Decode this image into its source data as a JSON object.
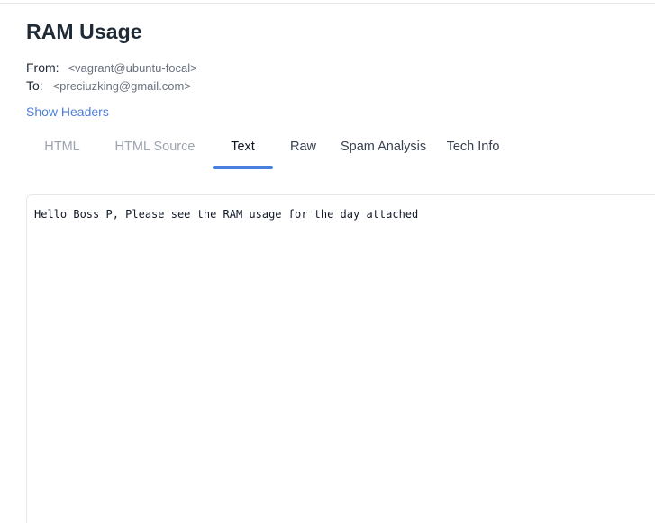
{
  "email": {
    "subject": "RAM Usage",
    "from_label": "From:",
    "from_value": "<vagrant@ubuntu-focal>",
    "to_label": "To:",
    "to_value": "<preciuzking@gmail.com>",
    "show_headers_label": "Show Headers"
  },
  "tabs": [
    {
      "label": "HTML",
      "active": false
    },
    {
      "label": "HTML Source",
      "active": false
    },
    {
      "label": "Text",
      "active": true
    },
    {
      "label": "Raw",
      "active": false
    },
    {
      "label": "Spam Analysis",
      "active": false
    },
    {
      "label": "Tech Info",
      "active": false
    }
  ],
  "body": {
    "text": "Hello Boss P, Please see the RAM usage for the day attached"
  },
  "colors": {
    "accent": "#4a7fe0",
    "link": "#4f7fd9",
    "muted_tab": "#9ca3af",
    "border": "#e5e7eb"
  }
}
